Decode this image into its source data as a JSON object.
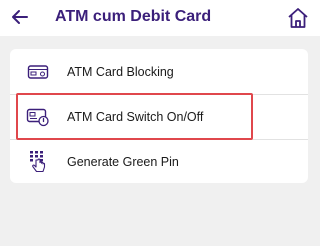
{
  "header": {
    "title": "ATM cum Debit Card",
    "back_icon": "arrow-left-icon",
    "home_icon": "home-icon"
  },
  "menu": {
    "items": [
      {
        "label": "ATM Card Blocking",
        "icon": "card-block-icon"
      },
      {
        "label": "ATM Card Switch On/Off",
        "icon": "card-switch-icon"
      },
      {
        "label": "Generate Green Pin",
        "icon": "keypad-touch-icon"
      }
    ]
  },
  "colors": {
    "title": "#3b1f7a",
    "icon": "#3b1f7a",
    "highlight": "#e0474c",
    "background": "#f0f0f0"
  }
}
